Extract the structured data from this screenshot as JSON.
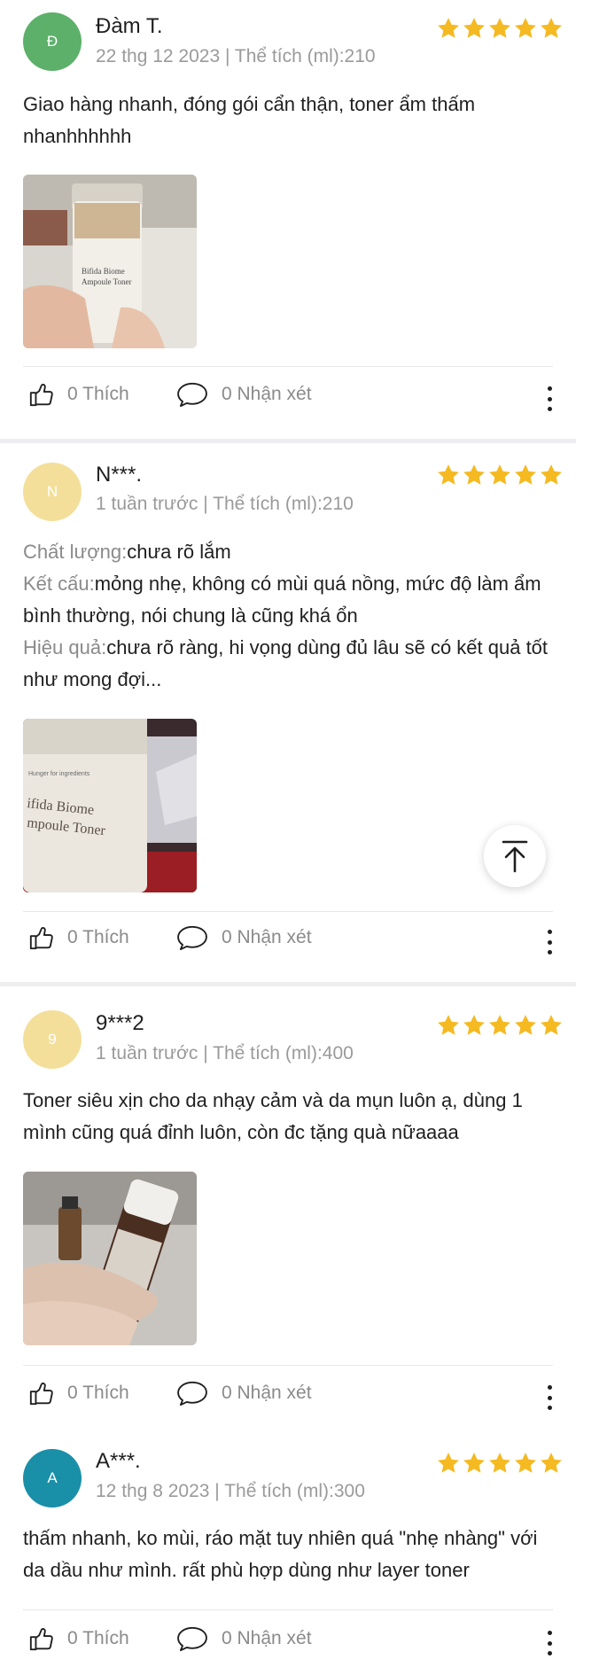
{
  "colors": {
    "star": "#f5b921",
    "meta_text": "#9a9a9a",
    "avatar_green": "#5cb06a",
    "avatar_yellow": "#f3df9a",
    "avatar_teal": "#1a8fa8"
  },
  "icons": {
    "like": "thumbs-up-icon",
    "comment": "speech-bubble-icon",
    "more": "more-vertical-icon",
    "scroll_top": "arrow-up-to-top-icon"
  },
  "reviews": [
    {
      "avatar_letter": "Đ",
      "name": "Đàm T.",
      "meta": "22 thg 12 2023 | Thể tích (ml):210",
      "rating": 5,
      "text": "Giao hàng nhanh, đóng gói cẩn thận, toner ẩm thấm nhanhhhhhh",
      "like_label": "0 Thích",
      "comment_label": "0 Nhận xét"
    },
    {
      "avatar_letter": "N",
      "name": "N***.",
      "meta": "1 tuần trước | Thể tích (ml):210",
      "rating": 5,
      "quality_label": "Chất lượng:",
      "quality_text": "chưa rõ lắm",
      "texture_label": "Kết cấu:",
      "texture_text": "mỏng nhẹ, không có mùi quá nồng, mức độ làm ẩm bình thường, nói chung là cũng khá ổn",
      "effect_label": "Hiệu quả:",
      "effect_text": "chưa rõ ràng, hi vọng dùng đủ lâu sẽ có kết quả tốt như mong đợi...",
      "like_label": "0 Thích",
      "comment_label": "0 Nhận xét"
    },
    {
      "avatar_letter": "9",
      "name": "9***2",
      "meta": "1 tuần trước | Thể tích (ml):400",
      "rating": 5,
      "text": "Toner siêu xịn cho da nhạy cảm và da mụn luôn ạ, dùng 1 mình cũng quá đỉnh luôn, còn đc tặng quà nữaaaa",
      "like_label": "0 Thích",
      "comment_label": "0 Nhận xét"
    },
    {
      "avatar_letter": "A",
      "name": "A***.",
      "meta": "12 thg 8 2023 | Thể tích (ml):300",
      "rating": 5,
      "text": "thấm nhanh, ko mùi, ráo mặt tuy nhiên quá \"nhẹ nhàng\" với da dầu như mình. rất phù hợp dùng như layer toner",
      "like_label": "0 Thích",
      "comment_label": "0 Nhận xét"
    }
  ],
  "photos": {
    "photo1_label": "Bifida Biome Ampoule Toner",
    "photo2_label": "Bifida Biome Ampoule Toner"
  }
}
